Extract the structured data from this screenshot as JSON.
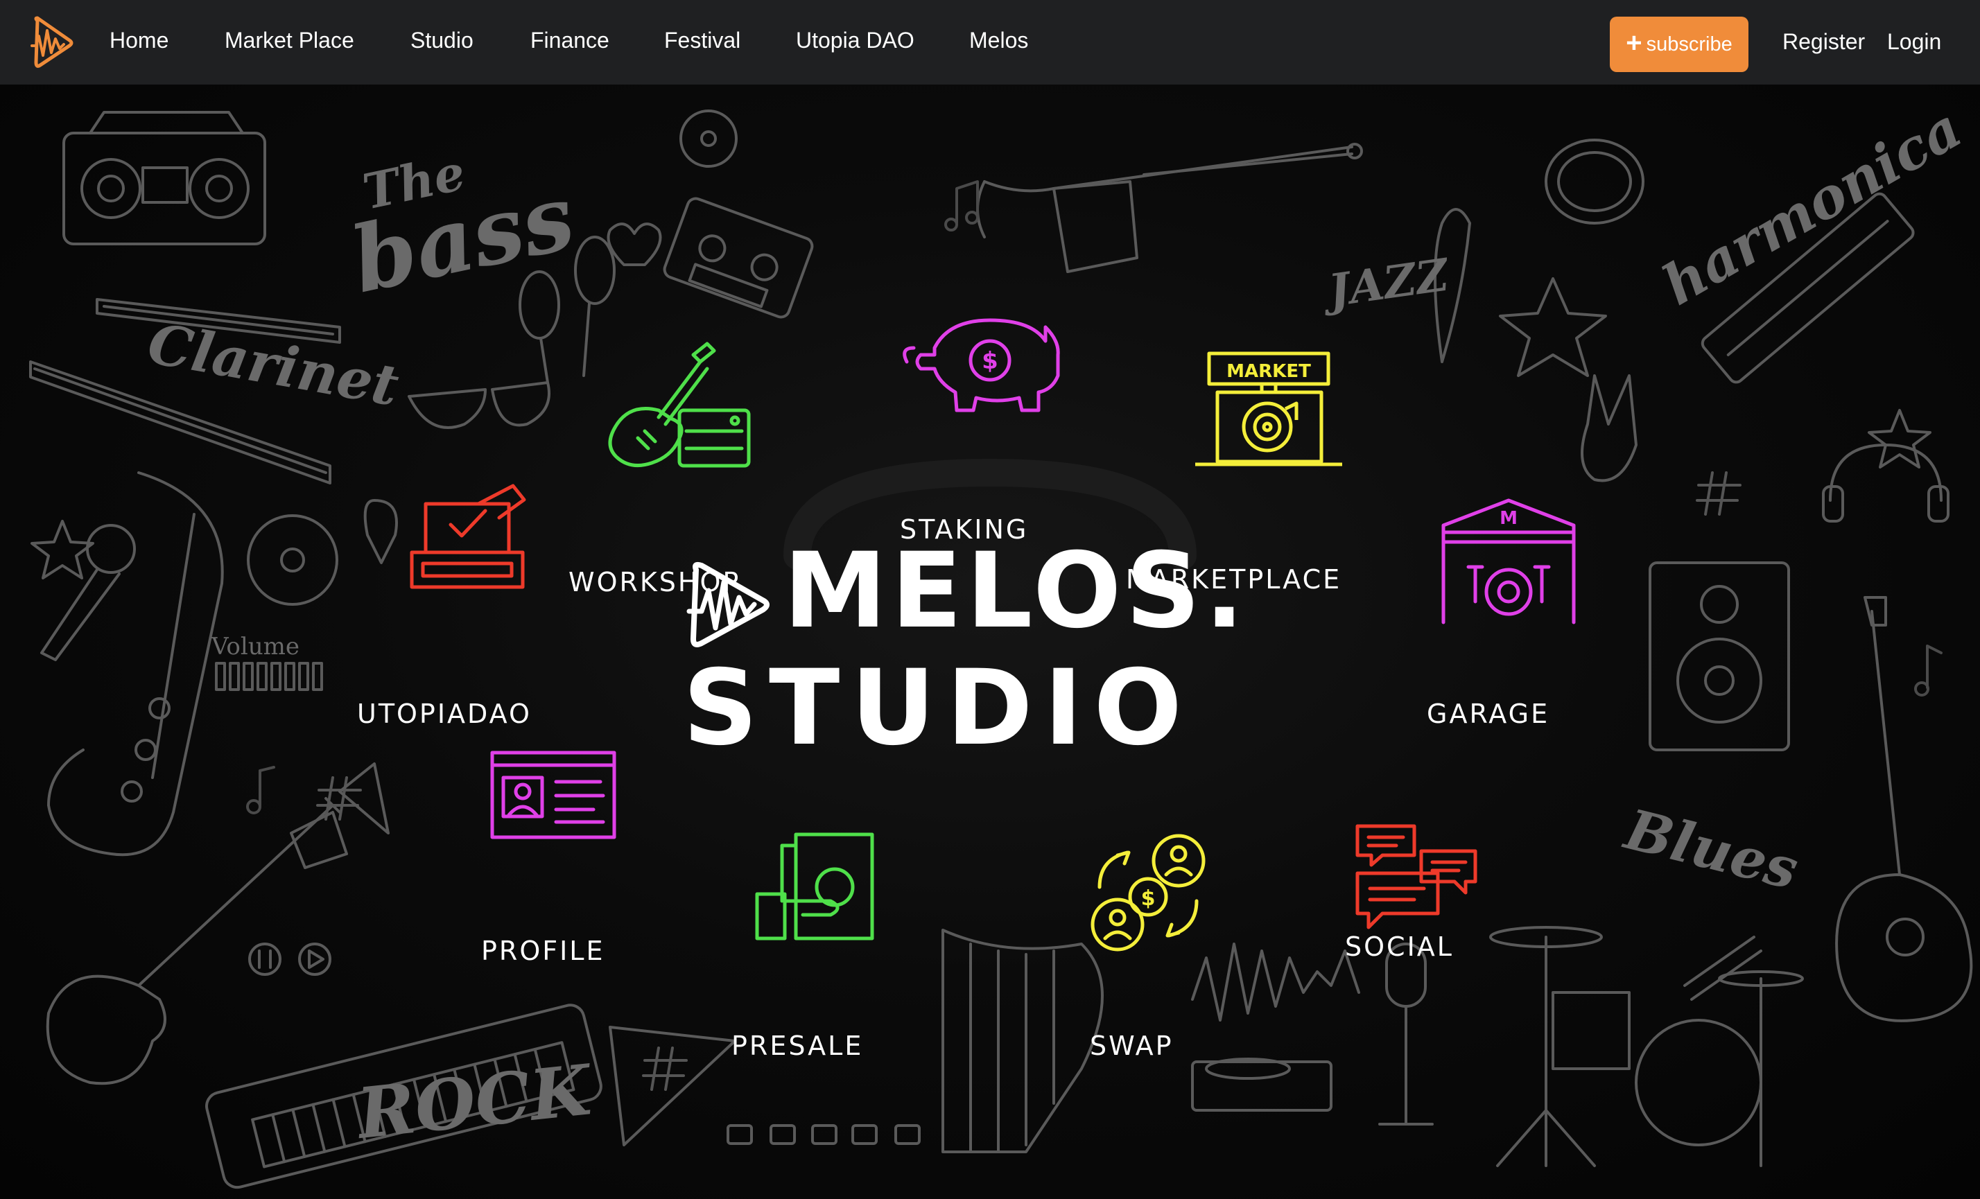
{
  "nav": {
    "items": [
      {
        "label": "Home"
      },
      {
        "label": "Market Place"
      },
      {
        "label": "Studio"
      },
      {
        "label": "Finance"
      },
      {
        "label": "Festival"
      },
      {
        "label": "Utopia DAO"
      },
      {
        "label": "Melos"
      }
    ],
    "subscribe_label": "subscribe",
    "register_label": "Register",
    "login_label": "Login"
  },
  "colors": {
    "navbar_bg": "#1f2022",
    "accent": "#f08c3a",
    "green": "#4fe04a",
    "magenta": "#e040e8",
    "yellow": "#f4ee3a",
    "red": "#ee3a2a"
  },
  "hero": {
    "title_line1": "MELOS.",
    "title_line2": "STUDIO",
    "background_doodles": {
      "the": "The",
      "bass": "bass",
      "clarinet": "Clarinet",
      "volume": "Volume",
      "jazz": "JAZZ",
      "harmonica": "harmonica",
      "blues": "Blues",
      "rock": "ROCK"
    },
    "features": {
      "workshop": {
        "label": "WORKSHOP",
        "icon": "guitar-amp-icon"
      },
      "staking": {
        "label": "STAKING",
        "icon": "piggy-bank-icon"
      },
      "marketplace": {
        "label": "MARKETPLACE",
        "icon": "market-stall-icon",
        "sign": "MARKET"
      },
      "utopiadao": {
        "label": "UTOPIADAO",
        "icon": "ballot-box-icon"
      },
      "garage": {
        "label": "GARAGE",
        "icon": "garage-drums-icon",
        "sign": "M"
      },
      "profile": {
        "label": "PROFILE",
        "icon": "profile-card-icon"
      },
      "presale": {
        "label": "PRESALE",
        "icon": "cash-hand-icon"
      },
      "swap": {
        "label": "SWAP",
        "icon": "swap-coins-icon"
      },
      "social": {
        "label": "SOCIAL",
        "icon": "chat-bubbles-icon"
      }
    }
  }
}
